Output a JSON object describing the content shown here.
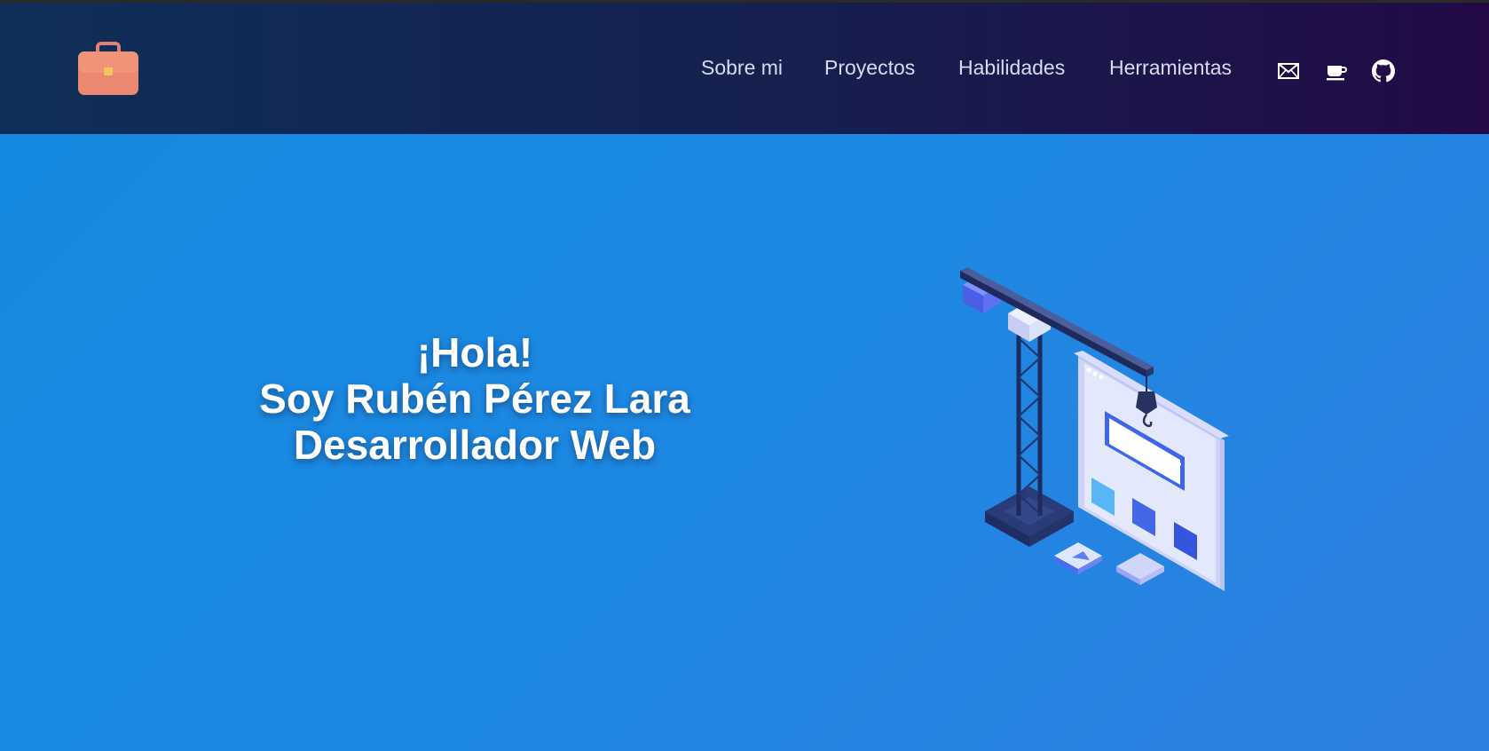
{
  "header": {
    "logo_icon": "briefcase-icon",
    "nav": [
      {
        "label": "Sobre mi"
      },
      {
        "label": "Proyectos"
      },
      {
        "label": "Habilidades"
      },
      {
        "label": "Herramientas"
      }
    ],
    "icons": [
      "mail-icon",
      "coffee-icon",
      "github-icon"
    ]
  },
  "hero": {
    "greeting": "¡Hola!",
    "name_line": "Soy Rubén Pérez Lara",
    "role_line": "Desarrollador Web",
    "illustration": "crane-building-website-illustration"
  },
  "colors": {
    "header_start": "#0f2f57",
    "header_end": "#230a45",
    "hero_bg": "#1d88e2",
    "logo": "#e9806a"
  }
}
